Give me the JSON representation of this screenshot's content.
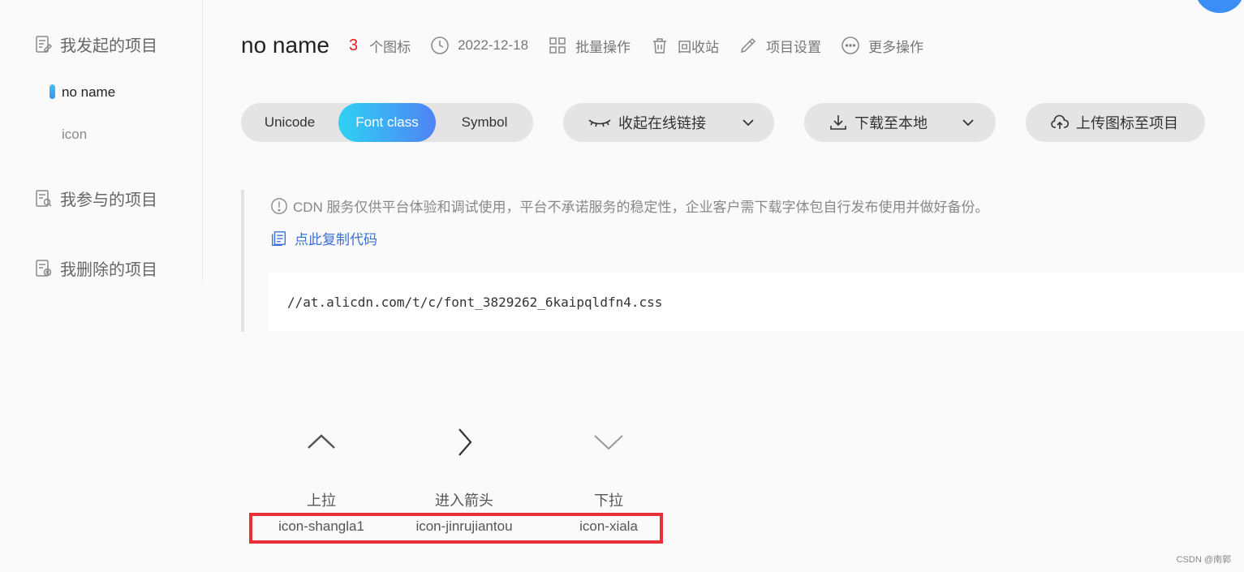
{
  "sidebar": {
    "my_projects": "我发起的项目",
    "project_active": "no name",
    "project_other": "icon",
    "joined_projects": "我参与的项目",
    "deleted_projects": "我删除的项目"
  },
  "header": {
    "title": "no name",
    "icon_count": "3",
    "icon_count_label": "个图标",
    "date": "2022-12-18",
    "batch": "批量操作",
    "recycle": "回收站",
    "settings": "项目设置",
    "more": "更多操作"
  },
  "toolbar": {
    "tabs": [
      "Unicode",
      "Font class",
      "Symbol"
    ],
    "active_tab": "Font class",
    "collapse_link": "收起在线链接",
    "download": "下载至本地",
    "upload": "上传图标至项目"
  },
  "notice": {
    "text": "CDN 服务仅供平台体验和调试使用，平台不承诺服务的稳定性，企业客户需下载字体包自行发布使用并做好备份。",
    "copy_code": "点此复制代码",
    "css_url": "//at.alicdn.com/t/c/font_3829262_6kaipqldfn4.css"
  },
  "icons": [
    {
      "name": "上拉",
      "class": "icon-shangla1",
      "glyph": "chevron-up-icon"
    },
    {
      "name": "进入箭头",
      "class": "icon-jinrujiantou",
      "glyph": "chevron-right-icon"
    },
    {
      "name": "下拉",
      "class": "icon-xiala",
      "glyph": "chevron-down-icon"
    }
  ],
  "colors": {
    "accent_gradient_start": "#2fd2f3",
    "accent_gradient_end": "#4f83f5",
    "count_red": "#e02020",
    "link_blue": "#3b6fd6",
    "highlight_red": "#e8303a"
  },
  "watermark": "CSDN @南郭"
}
